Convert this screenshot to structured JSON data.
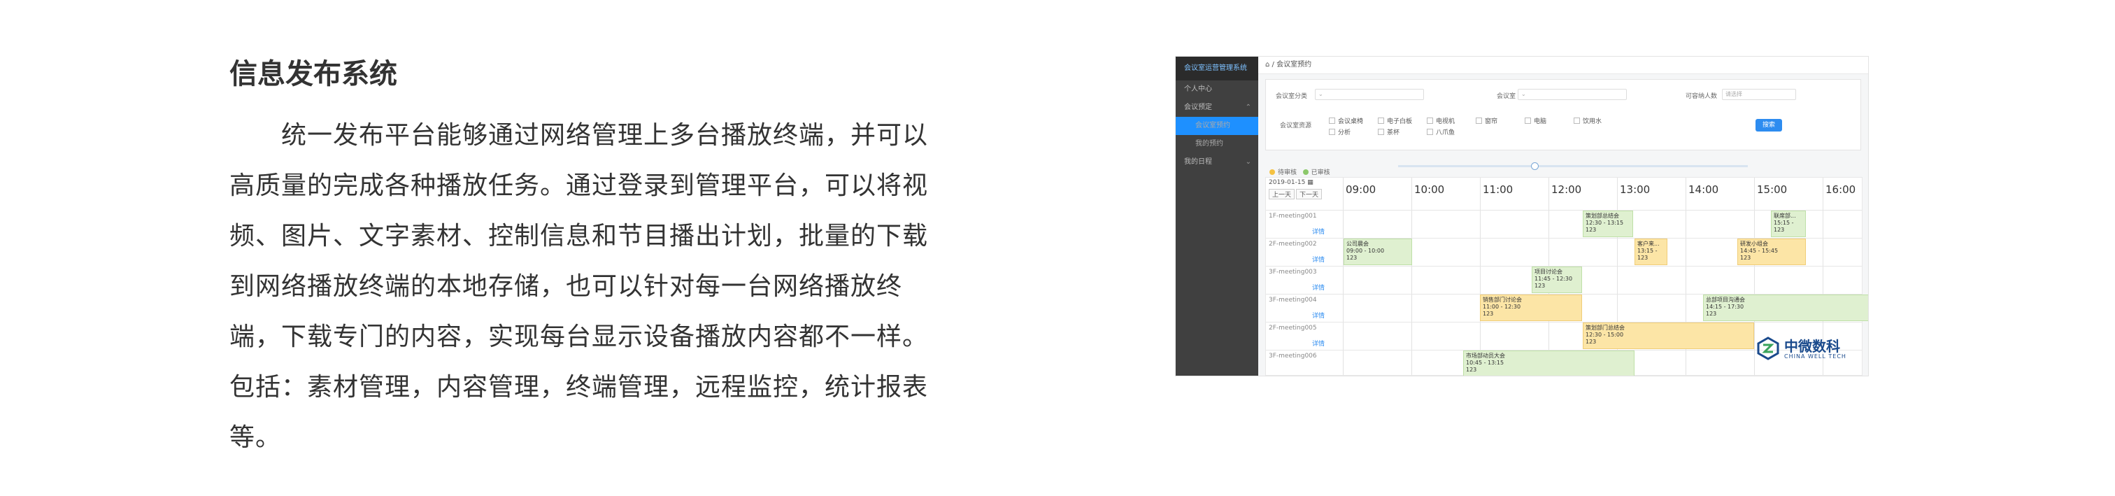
{
  "doc": {
    "title": "信息发布系统",
    "paragraph": "统一发布平台能够通过网络管理上多台播放终端，并可以高质量的完成各种播放任务。通过登录到管理平台，可以将视频、图片、文字素材、控制信息和节目播出计划，批量的下载到网络播放终端的本地存储，也可以针对每一台网络播放终端，下载专门的内容，实现每台显示设备播放内容都不一样。包括：素材管理，内容管理，终端管理，远程监控，统计报表等。"
  },
  "screenshot": {
    "sidebar": {
      "brand": "会议室运营管理系统",
      "items": [
        "个人中心",
        "会议预定",
        "会议室预约",
        "我的预约",
        "我的日程"
      ]
    },
    "breadcrumb": "会议室预约",
    "filters": {
      "area_label": "会议室分类",
      "room_label": "会议室",
      "capacity_label": "可容纳人数",
      "capacity_placeholder": "请选择",
      "equipment_label": "会议室资源",
      "equipment": [
        "会议桌椅",
        "电子白板",
        "电视机",
        "窗帘",
        "电脑",
        "饮用水",
        "分析",
        "茶杯",
        "八爪鱼"
      ],
      "search_button": "搜索"
    },
    "legend": [
      "待审核",
      "已审核"
    ],
    "legend_colors": {
      "pending": "#f5c242",
      "approved": "#8cc86a"
    },
    "date": "2019-01-15",
    "prev_day": "上一天",
    "next_day": "下一天",
    "hours": [
      "09:00",
      "10:00",
      "11:00",
      "12:00",
      "13:00",
      "14:00",
      "15:00",
      "16:00"
    ],
    "rooms": [
      "1F-meeting001",
      "2F-meeting002",
      "3F-meeting003",
      "3F-meeting004",
      "2F-meeting005",
      "3F-meeting006"
    ],
    "detail_label": "详情",
    "bookings": [
      {
        "title": "策划部总结会",
        "time": "12:30 - 13:15",
        "code": "123",
        "color": "g"
      },
      {
        "title": "联席部...",
        "time": "15:15 -",
        "code": "123",
        "color": "g"
      },
      {
        "title": "公司晨会",
        "time": "09:00 - 10:00",
        "code": "123",
        "color": "g"
      },
      {
        "title": "客户来...",
        "time": "13:15 -",
        "code": "123",
        "color": "y"
      },
      {
        "title": "研发小组会",
        "time": "14:45 - 15:45",
        "code": "123",
        "color": "y"
      },
      {
        "title": "项目讨论会",
        "time": "11:45 - 12:30",
        "code": "123",
        "color": "g"
      },
      {
        "title": "销售部门讨论会",
        "time": "11:00 - 12:30",
        "code": "123",
        "color": "y"
      },
      {
        "title": "总部项目沟通会",
        "time": "14:15 - 17:30",
        "code": "123",
        "color": "g"
      },
      {
        "title": "策划部门总结会",
        "time": "12:30 - 15:00",
        "code": "123",
        "color": "y"
      },
      {
        "title": "市场部动员大会",
        "time": "10:45 - 13:15",
        "code": "123",
        "color": "g"
      }
    ],
    "logo": {
      "cn": "中微数科",
      "en": "CHINA WELL TECH"
    }
  }
}
